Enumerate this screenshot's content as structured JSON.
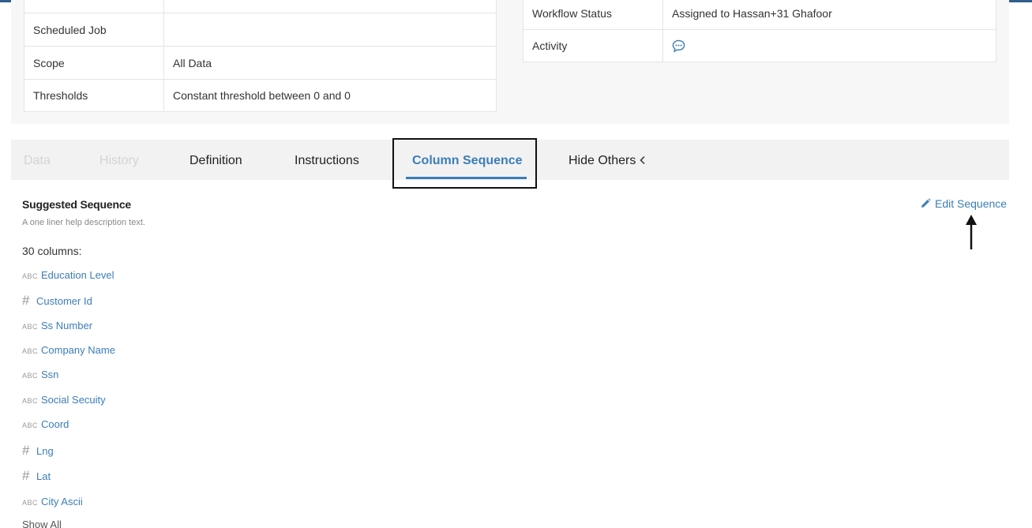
{
  "details_left": [
    {
      "key": "",
      "value": ""
    },
    {
      "key": "Scheduled Job",
      "value": ""
    },
    {
      "key": "Scope",
      "value": "All Data"
    },
    {
      "key": "Thresholds",
      "value": "Constant threshold between 0 and 0"
    }
  ],
  "details_right": {
    "workflow_status_key": "Workflow Status",
    "workflow_status_value": "Assigned to Hassan+31 Ghafoor",
    "activity_key": "Activity",
    "activity_icon": "chat-bubble-icon"
  },
  "tabs": [
    {
      "label": "Data",
      "state": "faded"
    },
    {
      "label": "History",
      "state": "faded"
    },
    {
      "label": "Definition",
      "state": "normal"
    },
    {
      "label": "Instructions",
      "state": "normal"
    },
    {
      "label": "Column Sequence",
      "state": "active"
    },
    {
      "label": "Hide Others",
      "state": "normal"
    }
  ],
  "sequence": {
    "title": "Suggested Sequence",
    "description": "A one liner help description text.",
    "count": "30",
    "count_suffix": "columns:",
    "edit_label": "Edit Sequence",
    "show_all": "Show All"
  },
  "columns": [
    {
      "type": "ABC",
      "name": "Education Level"
    },
    {
      "type": "#",
      "name": "Customer Id"
    },
    {
      "type": "ABC",
      "name": "Ss Number"
    },
    {
      "type": "ABC",
      "name": "Company Name"
    },
    {
      "type": "ABC",
      "name": "Ssn"
    },
    {
      "type": "ABC",
      "name": "Social Secuity"
    },
    {
      "type": "ABC",
      "name": "Coord"
    },
    {
      "type": "#",
      "name": "Lng"
    },
    {
      "type": "#",
      "name": "Lat"
    },
    {
      "type": "ABC",
      "name": "City Ascii"
    }
  ],
  "colors": {
    "accent": "#3b7db8",
    "tab_bar": "#f2f2f2",
    "panel": "#f7f7f7"
  }
}
